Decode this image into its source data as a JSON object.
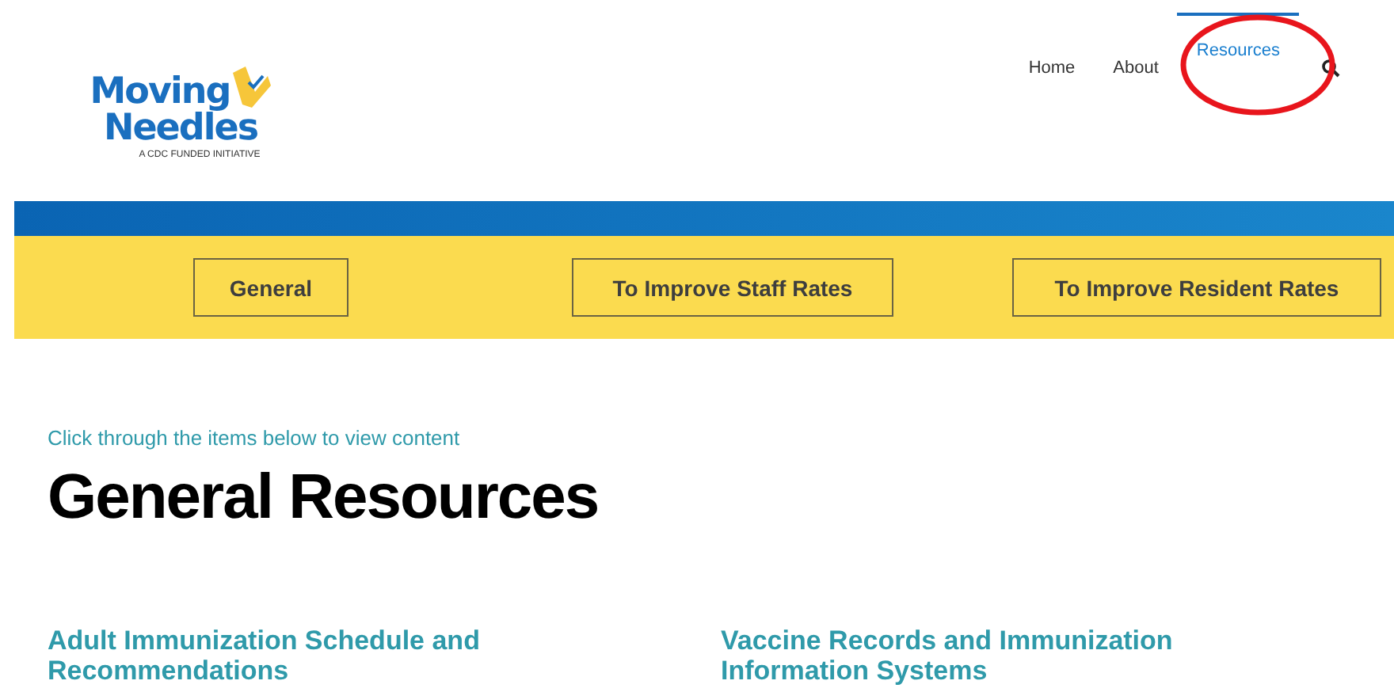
{
  "logo": {
    "line_1": "Moving",
    "line_2": "Needles",
    "tagline": "A CDC FUNDED INITIATIVE"
  },
  "nav": [
    {
      "label": "Home",
      "selected": false
    },
    {
      "label": "About",
      "selected": false
    },
    {
      "label": "Resources",
      "selected": true
    }
  ],
  "category_buttons": [
    {
      "label": "General"
    },
    {
      "label": "To Improve Staff Rates"
    },
    {
      "label": "To Improve Resident Rates"
    }
  ],
  "intro": "Click through the items below to view content",
  "heading": "General Resources",
  "items": [
    {
      "title": "Adult Immunization Schedule and Recommendations"
    },
    {
      "title": "Vaccine Records and Immunization Information Systems"
    }
  ]
}
